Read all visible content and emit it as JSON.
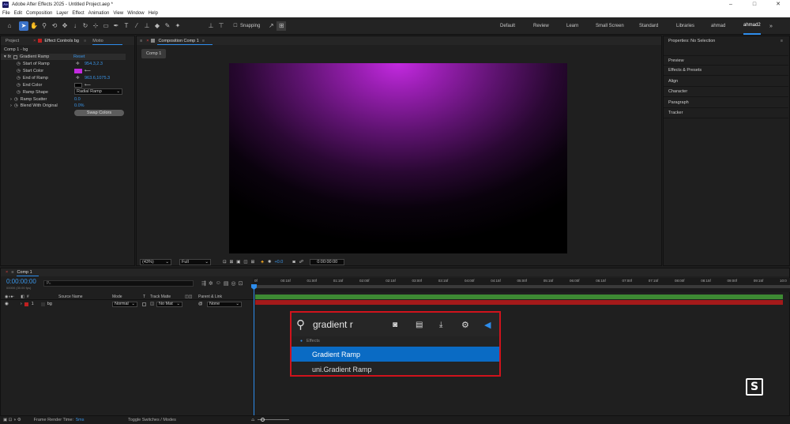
{
  "app": {
    "title": "Adobe After Effects 2025 - Untitled Project.aep *",
    "logo": "Ae",
    "win_buttons": [
      "–",
      "□",
      "✕"
    ]
  },
  "menu": [
    "File",
    "Edit",
    "Composition",
    "Layer",
    "Effect",
    "Animation",
    "View",
    "Window",
    "Help"
  ],
  "toolbar": {
    "snapping": "Snapping",
    "workspaces": [
      "Default",
      "Review",
      "Learn",
      "Small Screen",
      "Standard",
      "Libraries",
      "ahmad",
      "ahmad2"
    ],
    "active_workspace": "ahmad2"
  },
  "left_panel": {
    "tabs": [
      "Project",
      "Effect Controls bg",
      "Motio"
    ],
    "layer_path": "Comp 1 - bg",
    "effect_name": "Gradient Ramp",
    "reset": "Reset",
    "props": [
      {
        "label": "Start of Ramp",
        "value": "954.3,2.3"
      },
      {
        "label": "Start Color",
        "value": ""
      },
      {
        "label": "End of Ramp",
        "value": "963.6,1075.3"
      },
      {
        "label": "End Color",
        "value": ""
      },
      {
        "label": "Ramp Shape",
        "value": "Radial Ramp"
      },
      {
        "label": "Ramp Scatter",
        "value": "0.0"
      },
      {
        "label": "Blend With Original",
        "value": "0.0%"
      }
    ],
    "swap_button": "Swap Colors"
  },
  "comp_panel": {
    "tab": "Composition Comp 1",
    "sub_tab": "Comp 1",
    "zoom": "(43%)",
    "resolution": "Full",
    "exposure": "+0.0",
    "timecode": "0:00:00:00"
  },
  "right_panel": {
    "title": "Properties: No Selection",
    "items": [
      "Preview",
      "Effects & Presets",
      "Align",
      "Character",
      "Paragraph",
      "Tracker"
    ]
  },
  "timeline": {
    "tab": "Comp 1",
    "timecode": "0:00:00:00",
    "fps": "00000 (30.00 fps)",
    "search_placeholder": "Ρₕ",
    "columns": [
      "Source Name",
      "Mode",
      "T",
      "Track Matte",
      "Parent & Link"
    ],
    "layer": {
      "index": "1",
      "name": "bg",
      "mode": "Normal",
      "matte": "No Mat",
      "parent": "None"
    },
    "ruler": [
      "0f",
      "00:15f",
      "01:00f",
      "01:15f",
      "02:00f",
      "02:15f",
      "03:00f",
      "03:15f",
      "04:00f",
      "04:15f",
      "05:00f",
      "05:15f",
      "06:00f",
      "06:15f",
      "07:00f",
      "07:15f",
      "08:00f",
      "08:15f",
      "09:00f",
      "09:15f",
      "10:0"
    ]
  },
  "search_popup": {
    "query": "gradient r",
    "section": "Effects",
    "results": [
      "Gradient Ramp",
      "uni.Gradient Ramp"
    ],
    "selected": 0
  },
  "statusbar": {
    "render_label": "Frame Render Time:",
    "render_value": "5ms",
    "toggle": "Toggle Switches / Modes"
  },
  "colors": {
    "accent": "#2d8ceb",
    "start_color": "#c32ae0",
    "end_color": "#000000",
    "highlight": "#0a6bc4",
    "popup_border": "#d0131c"
  }
}
